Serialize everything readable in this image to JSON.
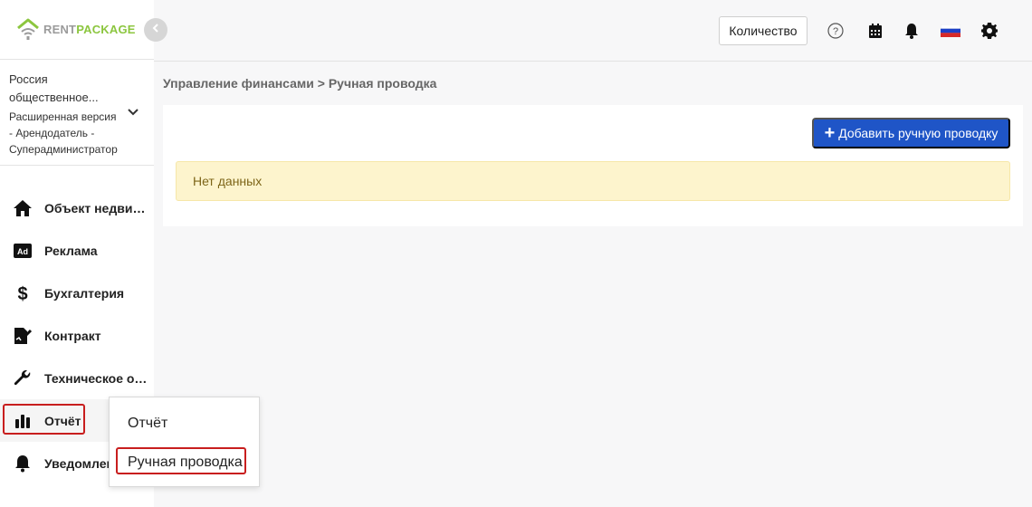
{
  "brand": {
    "rent": "RENT",
    "package": "PACKAGE",
    "brand_color": "#8cc63f"
  },
  "account": {
    "name": "Россия общественное...",
    "description": "Расширенная версия - Арендодатель - Суперадминистратор"
  },
  "sidebar": {
    "items": [
      {
        "label": "Объект недвижимости",
        "icon": "home-icon"
      },
      {
        "label": "Реклама",
        "icon": "ad-icon"
      },
      {
        "label": "Бухгалтерия",
        "icon": "dollar-icon"
      },
      {
        "label": "Контракт",
        "icon": "contract-icon"
      },
      {
        "label": "Техническое обслуживание",
        "icon": "wrench-icon"
      },
      {
        "label": "Отчёт",
        "icon": "bar-chart-icon"
      },
      {
        "label": "Уведомления",
        "icon": "bell-icon"
      }
    ]
  },
  "header": {
    "quantity_label": "Количество",
    "icons": [
      "help-icon",
      "calendar-icon",
      "bell-icon",
      "russia-flag-icon",
      "gear-icon"
    ]
  },
  "breadcrumb": "Управление финансами > Ручная проводка",
  "main": {
    "add_button_label": "Добавить ручную проводку",
    "empty_message": "Нет данных"
  },
  "dropdown": {
    "items": [
      "Отчёт",
      "Ручная проводка"
    ]
  },
  "colors": {
    "primary": "#1f55c7",
    "alert_bg": "#fdf4cd",
    "highlight": "#c81e1e"
  }
}
